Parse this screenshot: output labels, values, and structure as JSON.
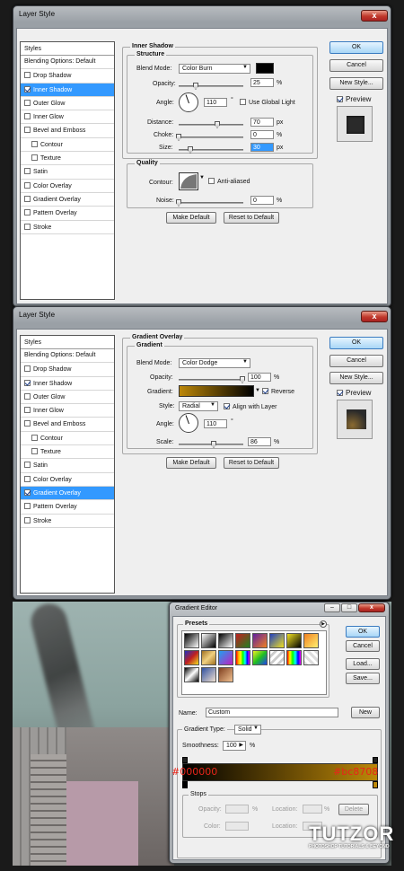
{
  "dialog1": {
    "title": "Layer Style",
    "close": "x",
    "styles_header": "Styles",
    "items": [
      {
        "label": "Blending Options: Default",
        "checkbox": false,
        "checked": false,
        "selected": false,
        "sub": false
      },
      {
        "label": "Drop Shadow",
        "checkbox": true,
        "checked": false,
        "selected": false,
        "sub": false
      },
      {
        "label": "Inner Shadow",
        "checkbox": true,
        "checked": true,
        "selected": true,
        "sub": false
      },
      {
        "label": "Outer Glow",
        "checkbox": true,
        "checked": false,
        "selected": false,
        "sub": false
      },
      {
        "label": "Inner Glow",
        "checkbox": true,
        "checked": false,
        "selected": false,
        "sub": false
      },
      {
        "label": "Bevel and Emboss",
        "checkbox": true,
        "checked": false,
        "selected": false,
        "sub": false
      },
      {
        "label": "Contour",
        "checkbox": true,
        "checked": false,
        "selected": false,
        "sub": true
      },
      {
        "label": "Texture",
        "checkbox": true,
        "checked": false,
        "selected": false,
        "sub": true
      },
      {
        "label": "Satin",
        "checkbox": true,
        "checked": false,
        "selected": false,
        "sub": false
      },
      {
        "label": "Color Overlay",
        "checkbox": true,
        "checked": false,
        "selected": false,
        "sub": false
      },
      {
        "label": "Gradient Overlay",
        "checkbox": true,
        "checked": false,
        "selected": false,
        "sub": false
      },
      {
        "label": "Pattern Overlay",
        "checkbox": true,
        "checked": false,
        "selected": false,
        "sub": false
      },
      {
        "label": "Stroke",
        "checkbox": true,
        "checked": false,
        "selected": false,
        "sub": false
      }
    ],
    "section_title": "Inner Shadow",
    "structure_title": "Structure",
    "blend_mode_label": "Blend Mode:",
    "blend_mode_value": "Color Burn",
    "blend_color": "#000000",
    "opacity_label": "Opacity:",
    "opacity_value": "25",
    "angle_label": "Angle:",
    "angle_value": "110",
    "degree": "°",
    "global_light_label": "Use Global Light",
    "distance_label": "Distance:",
    "distance_value": "70",
    "choke_label": "Choke:",
    "choke_value": "0",
    "size_label": "Size:",
    "size_value": "30",
    "percent": "%",
    "px": "px",
    "quality_title": "Quality",
    "contour_label": "Contour:",
    "anti_aliased_label": "Anti-aliased",
    "noise_label": "Noise:",
    "noise_value": "0",
    "make_default": "Make Default",
    "reset_default": "Reset to Default",
    "ok": "OK",
    "cancel": "Cancel",
    "new_style": "New Style...",
    "preview_label": "Preview"
  },
  "dialog2": {
    "title": "Layer Style",
    "close": "x",
    "styles_header": "Styles",
    "items": [
      {
        "label": "Blending Options: Default",
        "checkbox": false,
        "checked": false,
        "selected": false,
        "sub": false
      },
      {
        "label": "Drop Shadow",
        "checkbox": true,
        "checked": false,
        "selected": false,
        "sub": false
      },
      {
        "label": "Inner Shadow",
        "checkbox": true,
        "checked": true,
        "selected": false,
        "sub": false
      },
      {
        "label": "Outer Glow",
        "checkbox": true,
        "checked": false,
        "selected": false,
        "sub": false
      },
      {
        "label": "Inner Glow",
        "checkbox": true,
        "checked": false,
        "selected": false,
        "sub": false
      },
      {
        "label": "Bevel and Emboss",
        "checkbox": true,
        "checked": false,
        "selected": false,
        "sub": false
      },
      {
        "label": "Contour",
        "checkbox": true,
        "checked": false,
        "selected": false,
        "sub": true
      },
      {
        "label": "Texture",
        "checkbox": true,
        "checked": false,
        "selected": false,
        "sub": true
      },
      {
        "label": "Satin",
        "checkbox": true,
        "checked": false,
        "selected": false,
        "sub": false
      },
      {
        "label": "Color Overlay",
        "checkbox": true,
        "checked": false,
        "selected": false,
        "sub": false
      },
      {
        "label": "Gradient Overlay",
        "checkbox": true,
        "checked": true,
        "selected": true,
        "sub": false
      },
      {
        "label": "Pattern Overlay",
        "checkbox": true,
        "checked": false,
        "selected": false,
        "sub": false
      },
      {
        "label": "Stroke",
        "checkbox": true,
        "checked": false,
        "selected": false,
        "sub": false
      }
    ],
    "section_title": "Gradient Overlay",
    "gradient_title": "Gradient",
    "blend_mode_label": "Blend Mode:",
    "blend_mode_value": "Color Dodge",
    "opacity_label": "Opacity:",
    "opacity_value": "100",
    "gradient_label": "Gradient:",
    "reverse_label": "Reverse",
    "style_label": "Style:",
    "style_value": "Radial",
    "align_label": "Align with Layer",
    "angle_label": "Angle:",
    "angle_value": "110",
    "degree": "°",
    "scale_label": "Scale:",
    "scale_value": "86",
    "percent": "%",
    "make_default": "Make Default",
    "reset_default": "Reset to Default",
    "ok": "OK",
    "cancel": "Cancel",
    "new_style": "New Style...",
    "preview_label": "Preview"
  },
  "editor": {
    "title": "Gradient Editor",
    "presets_title": "Presets",
    "ok": "OK",
    "cancel": "Cancel",
    "load": "Load...",
    "save": "Save...",
    "name_label": "Name:",
    "name_value": "Custom",
    "new_button": "New",
    "gradient_type_label": "Gradient Type:",
    "gradient_type_value": "Solid",
    "smoothness_label": "Smoothness:",
    "smoothness_value": "100",
    "percent": "%",
    "color_left_label": "#000000",
    "color_right_label": "#bc8708",
    "color_left": "#000000",
    "color_right": "#bc8708",
    "stops_title": "Stops",
    "opacity_label": "Opacity:",
    "location_label": "Location:",
    "color_label": "Color:",
    "delete_button": "Delete"
  },
  "watermark": {
    "brand": "TUTZOR",
    "tagline": "PHOTOSHOP TUTORIALS & BEYOND"
  }
}
